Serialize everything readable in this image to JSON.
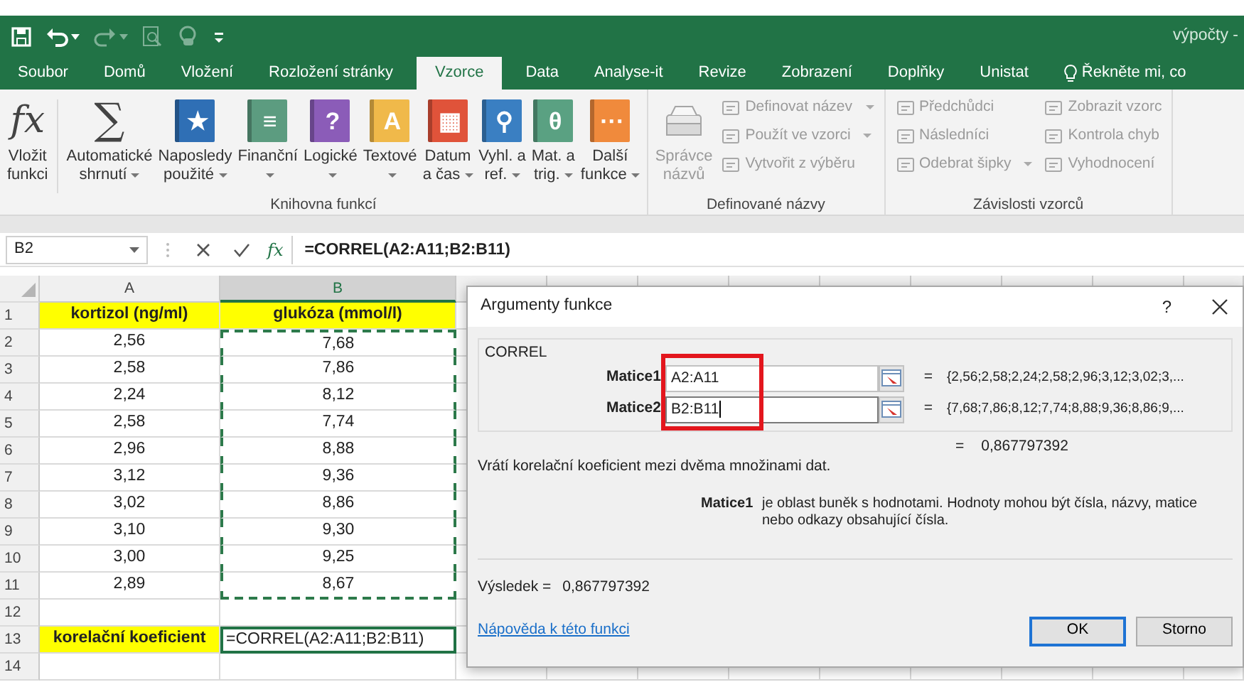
{
  "title_bar": {
    "quick_access": [
      {
        "kind": "save",
        "disabled": false
      },
      {
        "kind": "undo",
        "disabled": false,
        "dropdown": true
      },
      {
        "kind": "redo",
        "disabled": true,
        "dropdown": true
      },
      {
        "kind": "preview",
        "disabled": true
      },
      {
        "kind": "touch",
        "disabled": true
      },
      {
        "kind": "customize",
        "disabled": false
      }
    ],
    "document_title": "výpočty -"
  },
  "ribbon_tabs": [
    {
      "label": "Soubor",
      "selected": false
    },
    {
      "label": "Domů",
      "selected": false
    },
    {
      "label": "Vložení",
      "selected": false
    },
    {
      "label": "Rozložení stránky",
      "selected": false
    },
    {
      "label": "Vzorce",
      "selected": true
    },
    {
      "label": "Data",
      "selected": false
    },
    {
      "label": "Analyse-it",
      "selected": false
    },
    {
      "label": "Revize",
      "selected": false
    },
    {
      "label": "Zobrazení",
      "selected": false
    },
    {
      "label": "Doplňky",
      "selected": false
    },
    {
      "label": "Unistat",
      "selected": false
    }
  ],
  "tell_me": "Řekněte mi, co",
  "ribbon_groups": [
    {
      "label": "Knihovna funkcí",
      "items": [
        {
          "kind": "large",
          "glyph": "fx",
          "lines": [
            "Vložit",
            "funkci"
          ],
          "dropdown": false,
          "disabled": false
        },
        {
          "kind": "separator"
        },
        {
          "kind": "large",
          "glyph": "∑",
          "lines": [
            "Automatické",
            "shrnutí"
          ],
          "dropdown": true,
          "disabled": false
        },
        {
          "kind": "large",
          "glyph": "★",
          "color": "#2f6fb5",
          "lines": [
            "Naposledy",
            "použité"
          ],
          "dropdown": true,
          "disabled": false
        },
        {
          "kind": "large",
          "glyph": "≡",
          "color": "#5c9c80",
          "lines": [
            "Finanční"
          ],
          "dropdown": true,
          "disabled": false
        },
        {
          "kind": "large",
          "glyph": "?",
          "color": "#8b5cb8",
          "lines": [
            "Logické"
          ],
          "dropdown": true,
          "disabled": false
        },
        {
          "kind": "large",
          "glyph": "A",
          "color": "#f0b94a",
          "lines": [
            "Textové"
          ],
          "dropdown": true,
          "disabled": false
        },
        {
          "kind": "large",
          "glyph": "▦",
          "color": "#e0533a",
          "lines": [
            "Datum",
            "a čas"
          ],
          "dropdown": true,
          "disabled": false
        },
        {
          "kind": "large",
          "glyph": "⚲",
          "color": "#3a7fc2",
          "lines": [
            "Vyhl. a",
            "ref."
          ],
          "dropdown": true,
          "disabled": false
        },
        {
          "kind": "large",
          "glyph": "θ",
          "color": "#5aa182",
          "lines": [
            "Mat. a",
            "trig."
          ],
          "dropdown": true,
          "disabled": false
        },
        {
          "kind": "large",
          "glyph": "···",
          "color": "#f08a3c",
          "lines": [
            "Další",
            "funkce"
          ],
          "dropdown": true,
          "disabled": false
        }
      ]
    },
    {
      "label": "Definované názvy",
      "items": [
        {
          "kind": "large",
          "lines": [
            "Správce",
            "názvů"
          ],
          "dropdown": false,
          "disabled": true
        },
        {
          "kind": "stack",
          "items": [
            {
              "label": "Definovat název",
              "dropdown": true,
              "disabled": true
            },
            {
              "label": "Použít ve vzorci",
              "dropdown": true,
              "disabled": true
            },
            {
              "label": "Vytvořit z výběru",
              "dropdown": false,
              "disabled": true
            }
          ]
        }
      ]
    },
    {
      "label": "Závislosti vzorců",
      "items": [
        {
          "kind": "stack",
          "items": [
            {
              "label": "Předchůdci",
              "dropdown": false,
              "disabled": true
            },
            {
              "label": "Následníci",
              "dropdown": false,
              "disabled": true
            },
            {
              "label": "Odebrat šipky",
              "dropdown": true,
              "disabled": true
            }
          ]
        },
        {
          "kind": "stack",
          "items": [
            {
              "label": "Zobrazit vzorc",
              "dropdown": false,
              "disabled": true
            },
            {
              "label": "Kontrola chyb",
              "dropdown": false,
              "disabled": true
            },
            {
              "label": "Vyhodnocení",
              "dropdown": false,
              "disabled": true
            }
          ]
        }
      ]
    }
  ],
  "formula_bar": {
    "name_box": "B2",
    "function_glyph": "fx",
    "formula": "=CORREL(A2:A11;B2:B11)"
  },
  "sheet": {
    "columns": [
      {
        "label": "A",
        "selected": false
      },
      {
        "label": "B",
        "selected": true
      }
    ],
    "rows": [
      {
        "number": "1",
        "cells": [
          {
            "text": "kortizol (ng/ml)",
            "bold": true,
            "highlighted": true,
            "in_reference": false,
            "editing": false
          },
          {
            "text": "glukóza (mmol/l)",
            "bold": true,
            "highlighted": true,
            "in_reference": false,
            "editing": false
          }
        ]
      },
      {
        "number": "2",
        "cells": [
          {
            "text": "2,56",
            "bold": false,
            "highlighted": false,
            "in_reference": false,
            "editing": false
          },
          {
            "text": "7,68",
            "bold": false,
            "highlighted": false,
            "in_reference": true,
            "editing": false
          }
        ]
      },
      {
        "number": "3",
        "cells": [
          {
            "text": "2,58",
            "bold": false,
            "highlighted": false,
            "in_reference": false,
            "editing": false
          },
          {
            "text": "7,86",
            "bold": false,
            "highlighted": false,
            "in_reference": true,
            "editing": false
          }
        ]
      },
      {
        "number": "4",
        "cells": [
          {
            "text": "2,24",
            "bold": false,
            "highlighted": false,
            "in_reference": false,
            "editing": false
          },
          {
            "text": "8,12",
            "bold": false,
            "highlighted": false,
            "in_reference": true,
            "editing": false
          }
        ]
      },
      {
        "number": "5",
        "cells": [
          {
            "text": "2,58",
            "bold": false,
            "highlighted": false,
            "in_reference": false,
            "editing": false
          },
          {
            "text": "7,74",
            "bold": false,
            "highlighted": false,
            "in_reference": true,
            "editing": false
          }
        ]
      },
      {
        "number": "6",
        "cells": [
          {
            "text": "2,96",
            "bold": false,
            "highlighted": false,
            "in_reference": false,
            "editing": false
          },
          {
            "text": "8,88",
            "bold": false,
            "highlighted": false,
            "in_reference": true,
            "editing": false
          }
        ]
      },
      {
        "number": "7",
        "cells": [
          {
            "text": "3,12",
            "bold": false,
            "highlighted": false,
            "in_reference": false,
            "editing": false
          },
          {
            "text": "9,36",
            "bold": false,
            "highlighted": false,
            "in_reference": true,
            "editing": false
          }
        ]
      },
      {
        "number": "8",
        "cells": [
          {
            "text": "3,02",
            "bold": false,
            "highlighted": false,
            "in_reference": false,
            "editing": false
          },
          {
            "text": "8,86",
            "bold": false,
            "highlighted": false,
            "in_reference": true,
            "editing": false
          }
        ]
      },
      {
        "number": "9",
        "cells": [
          {
            "text": "3,10",
            "bold": false,
            "highlighted": false,
            "in_reference": false,
            "editing": false
          },
          {
            "text": "9,30",
            "bold": false,
            "highlighted": false,
            "in_reference": true,
            "editing": false
          }
        ]
      },
      {
        "number": "10",
        "cells": [
          {
            "text": "3,00",
            "bold": false,
            "highlighted": false,
            "in_reference": false,
            "editing": false
          },
          {
            "text": "9,25",
            "bold": false,
            "highlighted": false,
            "in_reference": true,
            "editing": false
          }
        ]
      },
      {
        "number": "11",
        "cells": [
          {
            "text": "2,89",
            "bold": false,
            "highlighted": false,
            "in_reference": false,
            "editing": false
          },
          {
            "text": "8,67",
            "bold": false,
            "highlighted": false,
            "in_reference": true,
            "editing": false
          }
        ]
      },
      {
        "number": "12"
      },
      {
        "number": "13",
        "cells": [
          {
            "text": "korelační koeficient",
            "bold": true,
            "highlighted": true,
            "in_reference": false,
            "editing": false
          },
          {
            "text": "=CORREL(A2:A11;B2:B11)",
            "bold": false,
            "highlighted": false,
            "in_reference": false,
            "editing": true
          }
        ]
      },
      {
        "number": "14"
      }
    ]
  },
  "dialog": {
    "title": "Argumenty funkce",
    "help": "?",
    "function_name": "CORREL",
    "arguments": [
      {
        "label": "Matice1",
        "value": "A2:A11",
        "equals": "=",
        "preview": "{2,56;2,58;2,24;2,58;2,96;3,12;3,02;3,...",
        "focused": false
      },
      {
        "label": "Matice2",
        "value": "B2:B11",
        "equals": "=",
        "preview": "{7,68;7,86;8,12;7,74;8,88;9,36;8,86;9,...",
        "focused": true
      }
    ],
    "result_equals": "=",
    "result_preview": "0,867797392",
    "description": "Vrátí korelační koeficient mezi dvěma množinami dat.",
    "argument_help": {
      "label": "Matice1",
      "lines": [
        "je oblast buněk s hodnotami. Hodnoty mohou být čísla, názvy, matice",
        "nebo odkazy obsahující čísla."
      ]
    },
    "result_label": "Výsledek =",
    "result_value": "0,867797392",
    "help_link": "Nápověda k této funkci",
    "buttons": [
      {
        "label": "OK",
        "default": true
      },
      {
        "label": "Storno",
        "default": false
      }
    ],
    "highlight_frame": true
  }
}
